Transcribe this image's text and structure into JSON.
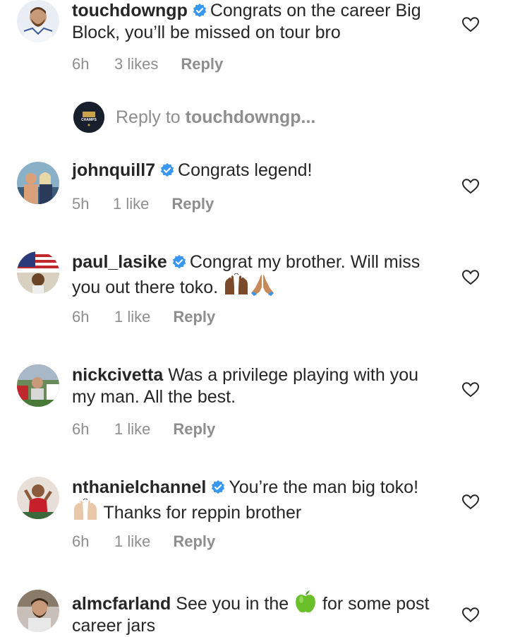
{
  "comments": [
    {
      "username": "touchdowngp",
      "verified": true,
      "text": "Congrats on the career Big Block, you’ll be missed on tour bro",
      "time": "6h",
      "likes": "3 likes",
      "reply": "Reply"
    },
    {
      "username": "johnquill7",
      "verified": true,
      "text": "Congrats legend!",
      "time": "5h",
      "likes": "1 like",
      "reply": "Reply"
    },
    {
      "username": "paul_lasike",
      "verified": true,
      "text": "Congrat my brother. Will miss you out there toko.",
      "time": "6h",
      "likes": "1 like",
      "reply": "Reply"
    },
    {
      "username": "nickcivetta",
      "verified": false,
      "text": "Was a privilege playing with you my man. All the best.",
      "time": "6h",
      "likes": "1 like",
      "reply": "Reply"
    },
    {
      "username": "nthanielchannel",
      "verified": true,
      "text_before": "You’re the man big toko!",
      "text_after": "Thanks for reppin brother",
      "time": "6h",
      "likes": "1 like",
      "reply": "Reply"
    },
    {
      "username": "almcfarland",
      "verified": false,
      "text_before": "See you in the",
      "text_after": "for some post career jars"
    }
  ],
  "reply_input": {
    "prefix": "Reply to",
    "target": "touchdowngp..."
  },
  "avatar_badge_text": "CHAMPS",
  "colors": {
    "verified": "#3897f0",
    "meta": "#8e8e8e",
    "text": "#262626"
  }
}
